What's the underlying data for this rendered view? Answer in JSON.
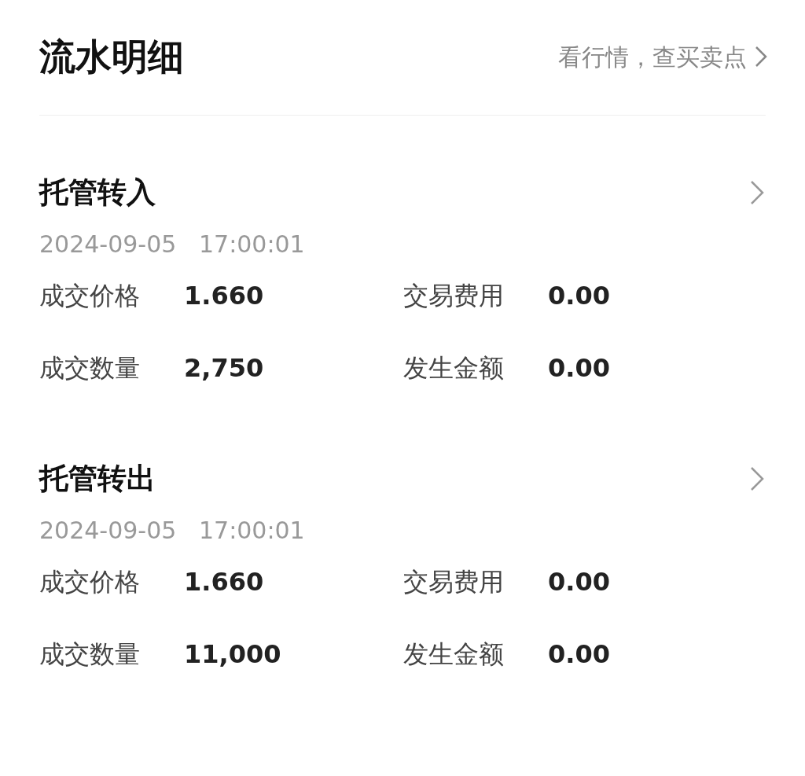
{
  "header": {
    "title": "流水明细",
    "link": "看行情，查买卖点"
  },
  "records": [
    {
      "title": "托管转入",
      "datetime": "2024-09-05   17:00:01",
      "fields": [
        {
          "label": "成交价格",
          "value": "1.660"
        },
        {
          "label": "交易费用",
          "value": "0.00"
        },
        {
          "label": "成交数量",
          "value": "2,750"
        },
        {
          "label": "发生金额",
          "value": "0.00"
        }
      ]
    },
    {
      "title": "托管转出",
      "datetime": "2024-09-05   17:00:01",
      "fields": [
        {
          "label": "成交价格",
          "value": "1.660"
        },
        {
          "label": "交易费用",
          "value": "0.00"
        },
        {
          "label": "成交数量",
          "value": "11,000"
        },
        {
          "label": "发生金额",
          "value": "0.00"
        }
      ]
    }
  ]
}
